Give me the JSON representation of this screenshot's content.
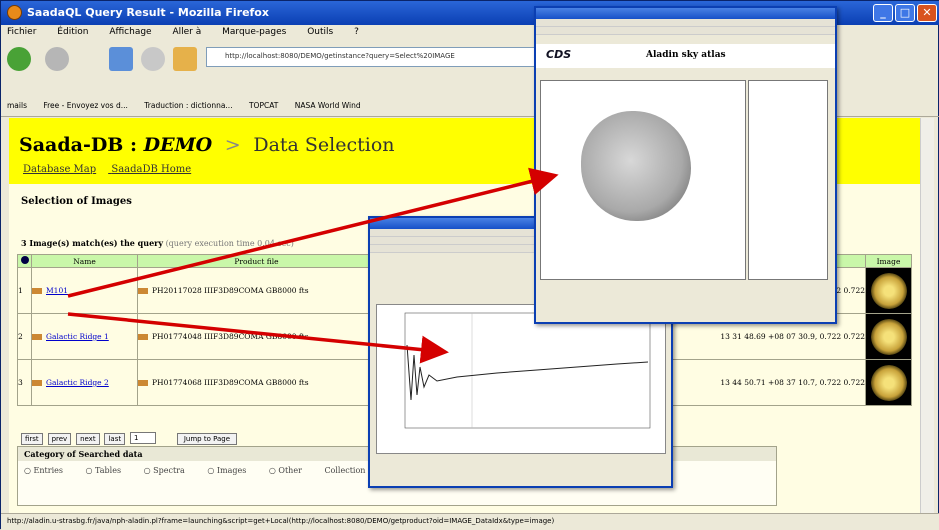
{
  "window": {
    "title": "SaadaQL Query Result - Mozilla Firefox"
  },
  "menu": [
    "Fichier",
    "Édition",
    "Affichage",
    "Aller à",
    "Marque-pages",
    "Outils",
    "?"
  ],
  "url": "http://localhost:8080/DEMO/getinstance?query=Select%20IMAGE",
  "bookmarks": [
    "mails",
    "Free - Envoyez vos d...",
    "Traduction : dictionna...",
    "TOPCAT",
    "NASA World Wind"
  ],
  "page": {
    "db": "Saada-DB :",
    "db_name": "DEMO",
    "sep": ">",
    "section": "Data Selection",
    "links": [
      "Database Map",
      "SaadaDB Home"
    ],
    "heading": "Selection of Images",
    "matches": "3 Image(s) match(es) the query",
    "matches_note": "(query execution time 0.04 sec)"
  },
  "table": {
    "headers": [
      "",
      "Name",
      "Product file",
      "",
      "Image"
    ],
    "rows": [
      {
        "idx": "1",
        "name": "M101",
        "file": "PH20117028 IIIF3D89COMA GB8000 fts",
        "coords": "0.722 0.722"
      },
      {
        "idx": "2",
        "name": "Galactic Ridge 1",
        "file": "PH01774048 IIIF3D89COMA GB8000 fts",
        "coords": "13 31 48.69 +08 07 30.9, 0.722 0.722"
      },
      {
        "idx": "3",
        "name": "Galactic Ridge 2",
        "file": "PH01774068 IIIF3D89COMA GB8000 fts",
        "coords": "13 44 50.71 +08 37 10.7, 0.722 0.722"
      }
    ]
  },
  "pager": {
    "first": "first",
    "prev": "prev",
    "next": "next",
    "last": "last",
    "page": "1",
    "jump": "Jump to Page"
  },
  "category": {
    "title": "Category of Searched data",
    "options": [
      "Entries",
      "Tables",
      "Spectra",
      "Images",
      "Other",
      "Collection"
    ]
  },
  "status": "http://aladin.u-strasbg.fr/java/nph-aladin.pl?frame=launching&script=get+Local(http://localhost:8080/DEMO/getproduct?oid=IMAGE_DataIdx&type=image)",
  "aladin": {
    "title": "Aladin sky atlas",
    "logo": "CDS"
  }
}
